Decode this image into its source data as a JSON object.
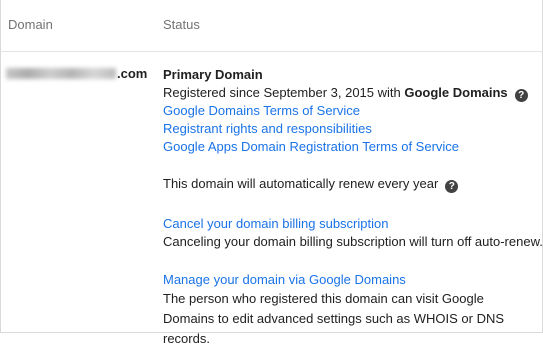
{
  "header": {
    "domain": "Domain",
    "status": "Status"
  },
  "row": {
    "domain_tld": ".com",
    "status": {
      "primary": "Primary Domain",
      "registered_prefix": "Registered since September 3, 2015 with",
      "registrar": "Google Domains",
      "links": [
        "Google Domains Terms of Service",
        "Registrant rights and responsibilities",
        "Google Apps Domain Registration Terms of Service"
      ],
      "auto_renew": "This domain will automatically renew every year",
      "cancel_link": "Cancel your domain billing subscription",
      "cancel_desc": "Canceling your domain billing subscription will turn off auto-renew.",
      "manage_link": "Manage your domain via Google Domains",
      "manage_desc": "The person who registered this domain can visit Google Domains to edit advanced settings such as WHOIS or DNS records."
    }
  },
  "icons": {
    "help": "?"
  },
  "colors": {
    "link": "#1a73e8",
    "header_text": "#737373"
  }
}
